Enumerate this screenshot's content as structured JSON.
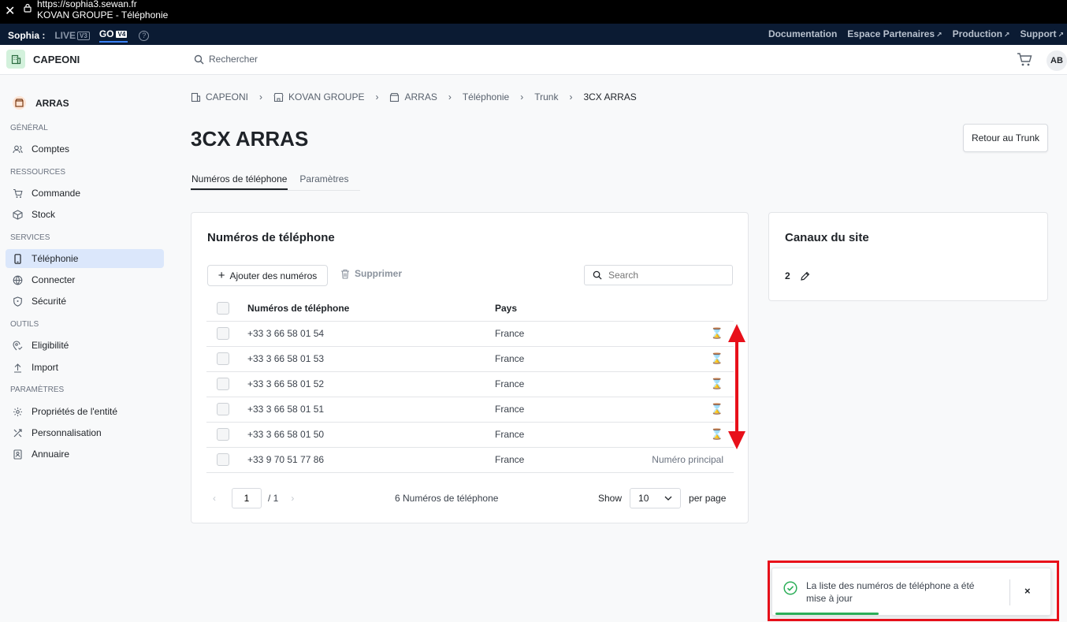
{
  "browser": {
    "url": "https://sophia3.sewan.fr",
    "page_title": "KOVAN GROUPE - Téléphonie"
  },
  "env_bar": {
    "brand": "Sophia :",
    "envs": [
      {
        "label": "LIVE",
        "version": "V3",
        "active": false
      },
      {
        "label": "GO",
        "version": "V4",
        "active": true
      }
    ],
    "help": "?",
    "links": [
      "Documentation",
      "Espace Partenaires",
      "Production",
      "Support"
    ]
  },
  "header": {
    "org_name": "CAPEONI",
    "search_placeholder": "Rechercher",
    "avatar_initials": "AB"
  },
  "sidebar": {
    "site_name": "ARRAS",
    "sections": {
      "general": "GÉNÉRAL",
      "ressources": "RESSOURCES",
      "services": "SERVICES",
      "outils": "OUTILS",
      "parametres": "PARAMÈTRES"
    },
    "items": {
      "comptes": "Comptes",
      "commande": "Commande",
      "stock": "Stock",
      "telephonie": "Téléphonie",
      "connecter": "Connecter",
      "securite": "Sécurité",
      "eligibilite": "Eligibilité",
      "import": "Import",
      "proprietes": "Propriétés de l'entité",
      "personnalisation": "Personnalisation",
      "annuaire": "Annuaire"
    }
  },
  "breadcrumb": [
    "CAPEONI",
    "KOVAN GROUPE",
    "ARRAS",
    "Téléphonie",
    "Trunk",
    "3CX ARRAS"
  ],
  "page": {
    "title": "3CX ARRAS",
    "back_button": "Retour au Trunk",
    "tabs": [
      "Numéros de téléphone",
      "Paramètres"
    ]
  },
  "numbers_card": {
    "title": "Numéros de téléphone",
    "add_button": "Ajouter des numéros",
    "delete_button": "Supprimer",
    "search_placeholder": "Search",
    "columns": [
      "Numéros de téléphone",
      "Pays"
    ],
    "rows": [
      {
        "number": "+33 3 66 58 01 54",
        "country": "France",
        "status": "⌛"
      },
      {
        "number": "+33 3 66 58 01 53",
        "country": "France",
        "status": "⌛"
      },
      {
        "number": "+33 3 66 58 01 52",
        "country": "France",
        "status": "⌛"
      },
      {
        "number": "+33 3 66 58 01 51",
        "country": "France",
        "status": "⌛"
      },
      {
        "number": "+33 3 66 58 01 50",
        "country": "France",
        "status": "⌛"
      },
      {
        "number": "+33 9 70 51 77 86",
        "country": "France",
        "status": "Numéro principal"
      }
    ],
    "pagination": {
      "current_page": "1",
      "total_pages": "/ 1",
      "count_label": "6 Numéros de téléphone",
      "show_label": "Show",
      "page_size": "10",
      "per_page_label": "per page"
    }
  },
  "channels_card": {
    "title": "Canaux du site",
    "value": "2"
  },
  "toast": {
    "message": "La liste des numéros de téléphone a été mise à jour",
    "close": "×",
    "progress": 0.37
  },
  "colors": {
    "accent": "#3b82f6",
    "active_nav": "#dbe7fb",
    "pending": "#f0a020",
    "success": "#2cae58",
    "annotation": "#e8101a"
  }
}
